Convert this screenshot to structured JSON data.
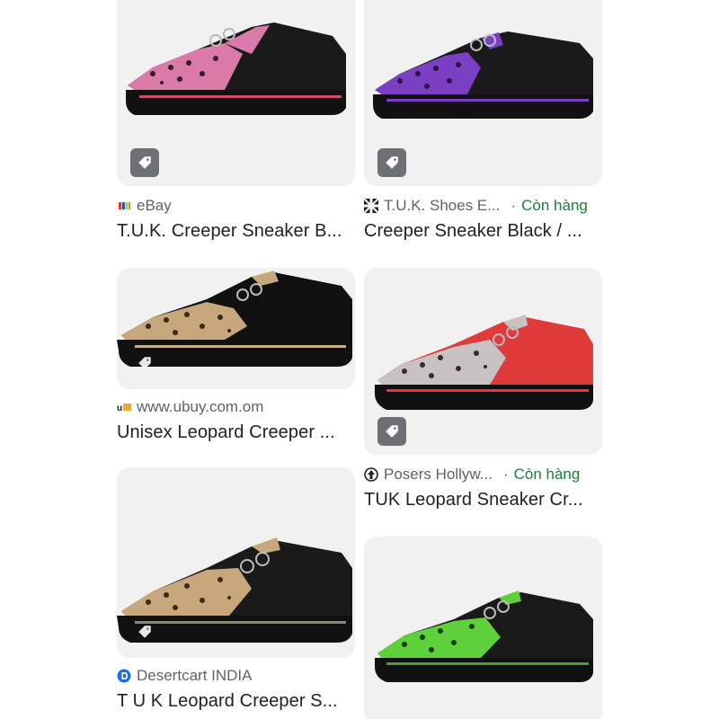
{
  "results": [
    {
      "source": "eBay",
      "title": "T.U.K. Creeper Sneaker B...",
      "stock": "",
      "favicon": "ebay-icon",
      "accent": "#d97aa8"
    },
    {
      "source": "T.U.K. Shoes E...",
      "title": "Creeper Sneaker Black / ...",
      "stock": "Còn hàng",
      "favicon": "tuk-icon",
      "accent": "#7b3fc4"
    },
    {
      "source": "www.ubuy.com.om",
      "title": "Unisex Leopard Creeper ...",
      "stock": "",
      "favicon": "ubuy-icon",
      "accent": "#c9a77c"
    },
    {
      "source": "Posers Hollyw...",
      "title": "TUK Leopard Sneaker Cr...",
      "stock": "Còn hàng",
      "favicon": "posers-icon",
      "accent": "#e03a3a"
    },
    {
      "source": "Desertcart INDIA",
      "title": "T U K Leopard Creeper S...",
      "stock": "",
      "favicon": "desertcart-icon",
      "accent": "#c9a77c"
    },
    {
      "source": "",
      "title": "",
      "stock": "",
      "favicon": "",
      "accent": "#5ed13a"
    }
  ],
  "colors": {
    "in_stock": "#188038",
    "muted": "#5f6368",
    "card_bg": "#f1f1f1"
  }
}
